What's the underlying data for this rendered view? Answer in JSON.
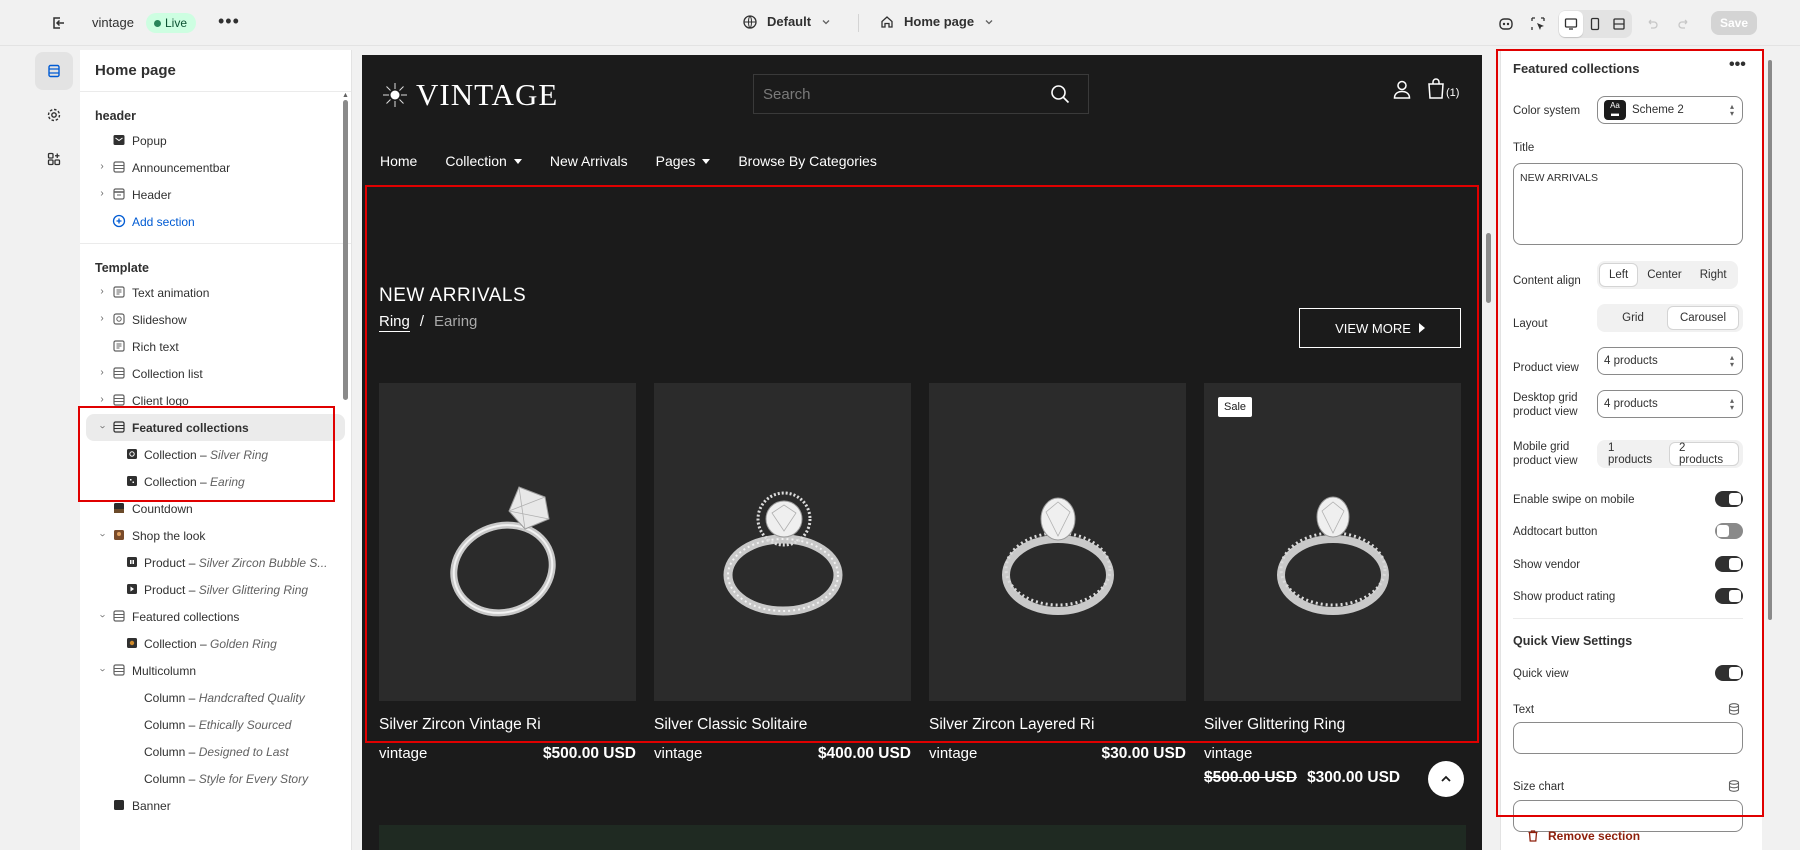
{
  "topbar": {
    "store_name": "vintage",
    "live_label": "Live",
    "more_label": "•••",
    "theme_label": "Default",
    "page_label": "Home page",
    "save_label": "Save"
  },
  "sidebar": {
    "title": "Home page",
    "header_group": "header",
    "header_items": [
      {
        "label": "Popup"
      },
      {
        "label": "Announcementbar"
      },
      {
        "label": "Header"
      },
      {
        "label": "Add section"
      }
    ],
    "template_group": "Template",
    "template_items": [
      {
        "label": "Text animation"
      },
      {
        "label": "Slideshow"
      },
      {
        "label": "Rich text"
      },
      {
        "label": "Collection list"
      },
      {
        "label": "Client logo"
      },
      {
        "label": "Featured collections"
      },
      {
        "label": "Collection – ",
        "sub": "Silver Ring"
      },
      {
        "label": "Collection – ",
        "sub": "Earing"
      },
      {
        "label": "Countdown"
      },
      {
        "label": "Shop the look"
      },
      {
        "label": "Product – ",
        "sub": "Silver Zircon Bubble S..."
      },
      {
        "label": "Product – ",
        "sub": "Silver Glittering Ring"
      },
      {
        "label": "Featured collections"
      },
      {
        "label": "Collection – ",
        "sub": "Golden Ring"
      },
      {
        "label": "Multicolumn"
      },
      {
        "label": "Column – ",
        "sub": "Handcrafted Quality"
      },
      {
        "label": "Column – ",
        "sub": "Ethically Sourced"
      },
      {
        "label": "Column – ",
        "sub": "Designed to Last"
      },
      {
        "label": "Column – ",
        "sub": "Style for Every Story"
      },
      {
        "label": "Banner"
      }
    ]
  },
  "preview": {
    "logo": "VINTAGE",
    "search_placeholder": "Search",
    "cart_count": "(1)",
    "nav": [
      "Home",
      "Collection",
      "New Arrivals",
      "Pages",
      "Browse By Categories"
    ],
    "section_title": "NEW ARRIVALS",
    "tab_active": "Ring",
    "tab_slash": "/",
    "tab_other": "Earing",
    "view_more": "VIEW MORE",
    "products": [
      {
        "name": "Silver Zircon Vintage Ri",
        "vendor": "vintage",
        "price": "$500.00 USD"
      },
      {
        "name": "Silver Classic Solitaire",
        "vendor": "vintage",
        "price": "$400.00 USD"
      },
      {
        "name": "Silver Zircon Layered Ri",
        "vendor": "vintage",
        "price": "$30.00 USD"
      },
      {
        "name": "Silver Glittering Ring",
        "vendor": "vintage",
        "badge": "Sale",
        "price_old": "$500.00 USD",
        "price": "$300.00 USD"
      }
    ]
  },
  "panel": {
    "title": "Featured collections",
    "more": "•••",
    "color_system_label": "Color system",
    "color_system_value": "Scheme 2",
    "scheme_chip": "Aa",
    "title_label": "Title",
    "title_value": "NEW ARRIVALS",
    "content_align_label": "Content align",
    "content_align_options": [
      "Left",
      "Center",
      "Right"
    ],
    "content_align_selected": "Left",
    "layout_label": "Layout",
    "layout_options": [
      "Grid",
      "Carousel"
    ],
    "layout_selected": "Carousel",
    "product_view_label": "Product view",
    "product_view_value": "4 products",
    "desktop_grid_label": "Desktop grid product view",
    "desktop_grid_value": "4 products",
    "mobile_grid_label": "Mobile grid product view",
    "mobile_grid_options": [
      "1 products",
      "2 products"
    ],
    "mobile_grid_selected": "2 products",
    "toggles": [
      {
        "label": "Enable swipe on mobile",
        "on": true
      },
      {
        "label": "Addtocart button",
        "on": false
      },
      {
        "label": "Show vendor",
        "on": true
      },
      {
        "label": "Show product rating",
        "on": true
      }
    ],
    "quick_view_heading": "Quick View Settings",
    "quick_view_label": "Quick view",
    "quick_view_on": true,
    "text_label": "Text",
    "size_chart_label": "Size chart",
    "remove_label": "Remove section"
  },
  "colors": {
    "accent": "#e00000",
    "preview_bg": "#1b1b1b",
    "card_bg": "#2b2b2b",
    "live_badge": "#cdfee1",
    "link_blue": "#005bd3",
    "remove_red": "#8e1f0b"
  }
}
